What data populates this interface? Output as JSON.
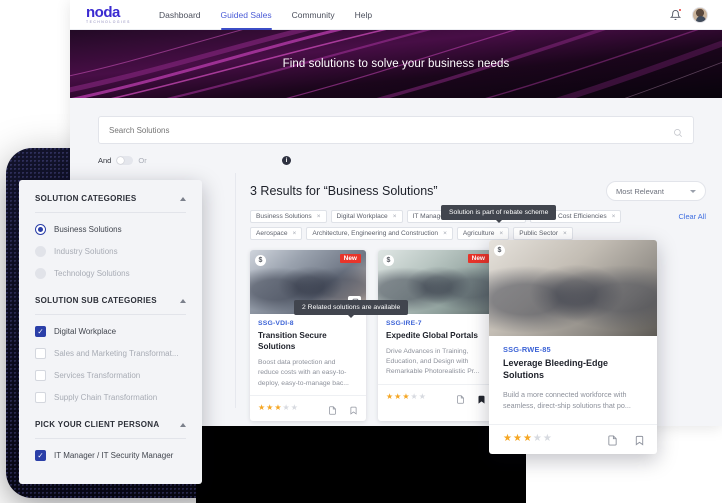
{
  "header": {
    "logo_main": "noda",
    "logo_sub": "TECHNOLOGIES",
    "nav": [
      {
        "label": "Dashboard",
        "active": false
      },
      {
        "label": "Guided Sales",
        "active": true
      },
      {
        "label": "Community",
        "active": false
      },
      {
        "label": "Help",
        "active": false
      }
    ],
    "bell_icon": "notification-bell-icon",
    "avatar": "user-avatar"
  },
  "hero": {
    "title": "Find solutions to solve your business needs"
  },
  "search": {
    "placeholder": "Search Solutions",
    "value": "",
    "icon": "search-icon"
  },
  "operator": {
    "and_label": "And",
    "or_label": "Or",
    "info_label": "i"
  },
  "results": {
    "title": "3 Results for “Business Solutions”",
    "sort_value": "Most Relevant",
    "clear_all": "Clear All",
    "chips": [
      "Business Solutions",
      "Digital Workplace",
      "IT Manager / IT Security Manager",
      "Driving Cost Efficiencies",
      "Aerospace",
      "Architecture, Engineering and Construction",
      "Agriculture",
      "Public Sector"
    ]
  },
  "tooltips": {
    "rebate": "Solution is part of rebate scheme",
    "related": "2 Related solutions are available"
  },
  "cards": [
    {
      "code": "SSG-VDI-8",
      "title": "Transition Secure Solutions",
      "desc": "Boost data protection and reduce costs with an easy-to-deploy, easy-to-manage bac...",
      "badge_dollar": "$",
      "badge_new": "New",
      "rating": 3,
      "rating_max": 5,
      "bookmarked": false,
      "has_related": true
    },
    {
      "code": "SSG-IRE-7",
      "title": "Expedite Global Portals",
      "desc": "Drive Advances in Training, Education, and Design with Remarkable Photorealistic Pr...",
      "badge_dollar": "$",
      "badge_new": "New",
      "rating": 3,
      "rating_max": 5,
      "bookmarked": true,
      "has_related": false
    },
    {
      "code": "SSG-RWE-85",
      "title": "Leverage Bleeding-Edge Solutions",
      "desc": "Build a more connected workforce with seamless, direct-ship solutions that po...",
      "badge_dollar": "$",
      "badge_new": "",
      "rating": 3,
      "rating_max": 5,
      "bookmarked": false,
      "has_related": false
    }
  ],
  "filters": {
    "sections": [
      {
        "title": "SOLUTION CATEGORIES",
        "type": "radio",
        "options": [
          {
            "label": "Business Solutions",
            "selected": true
          },
          {
            "label": "Industry Solutions",
            "selected": false
          },
          {
            "label": "Technology Solutions",
            "selected": false
          }
        ]
      },
      {
        "title": "SOLUTION SUB CATEGORIES",
        "type": "checkbox",
        "options": [
          {
            "label": "Digital Workplace",
            "selected": true
          },
          {
            "label": "Sales and Marketing Transformat...",
            "selected": false
          },
          {
            "label": "Services Transformation",
            "selected": false
          },
          {
            "label": "Supply Chain Transformation",
            "selected": false
          }
        ]
      },
      {
        "title": "PICK YOUR CLIENT PERSONA",
        "type": "checkbox",
        "options": [
          {
            "label": "IT Manager / IT Security Manager",
            "selected": true
          }
        ]
      }
    ]
  },
  "colors": {
    "brand": "#3b2bd1",
    "accent": "#2b3fa8",
    "link": "#3f6ee0",
    "star": "#f5a623",
    "new_badge": "#e8342a"
  }
}
